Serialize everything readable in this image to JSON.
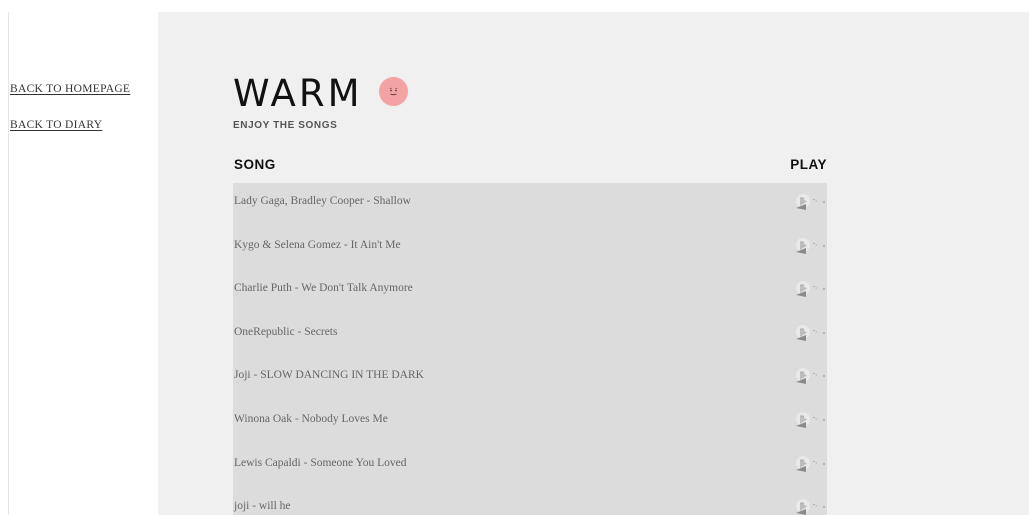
{
  "sidebar": {
    "links": [
      {
        "label": "BACK TO HOMEPAGE"
      },
      {
        "label": "BACK TO DIARY"
      }
    ]
  },
  "main": {
    "title": "WARM",
    "subtitle": "ENJOY THE SONGS",
    "mood_color": "#f4a3a3",
    "table": {
      "song_header": "SONG",
      "play_header": "PLAY",
      "rows": [
        {
          "title": "Lady Gaga, Bradley Cooper - Shallow",
          "icon": "play-icon"
        },
        {
          "title": "Kygo & Selena Gomez - It Ain't Me",
          "icon": "play-icon"
        },
        {
          "title": "Charlie Puth - We Don't Talk Anymore",
          "icon": "play-icon"
        },
        {
          "title": "OneRepublic - Secrets",
          "icon": "play-icon"
        },
        {
          "title": "Joji - SLOW DANCING IN THE DARK",
          "icon": "play-icon"
        },
        {
          "title": "Winona Oak - Nobody Loves Me",
          "icon": "play-icon"
        },
        {
          "title": "Lewis Capaldi - Someone You Loved",
          "icon": "play-icon"
        },
        {
          "title": "joji - will he",
          "icon": "play-icon"
        }
      ]
    }
  },
  "colors": {
    "panel_bg": "#f0f0f0",
    "table_bg": "#dcdcdc",
    "text_dark": "#111111",
    "text_muted": "#666666"
  }
}
